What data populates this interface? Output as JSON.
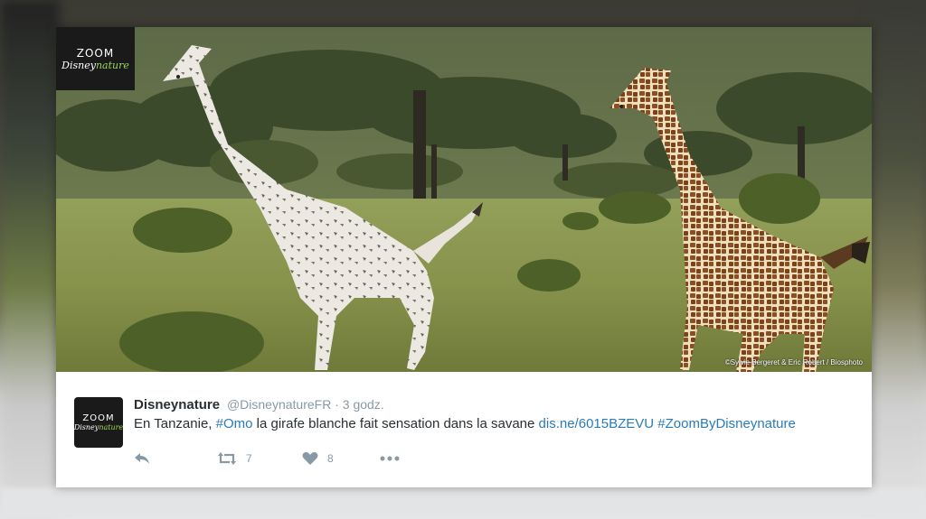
{
  "photo": {
    "logo": {
      "zoom": "ZOOM",
      "brand_prefix": "Disney",
      "brand_suffix": "nature"
    },
    "credit": "©Sylvie Bergeret & Eric Robert / Biosphoto"
  },
  "tweet": {
    "avatar": {
      "zoom": "ZOOM",
      "brand_prefix": "Disney",
      "brand_suffix": "nature"
    },
    "display_name": "Disneynature",
    "handle": "@DisneynatureFR",
    "separator": "·",
    "time": "3 godz.",
    "text": {
      "part1": "En Tanzanie, ",
      "hashtag1": "#Omo",
      "part2": " la girafe blanche fait sensation dans la savane ",
      "link": "dis.ne/6015BZEVU",
      "part3": " ",
      "hashtag2": "#ZoomByDisneynature"
    },
    "actions": {
      "retweet_count": "7",
      "like_count": "8"
    }
  },
  "colors": {
    "link": "#2b7bb9",
    "muted": "#8899a6",
    "text": "#292f33",
    "logo_accent": "#9ad25a"
  },
  "icons": [
    "reply-icon",
    "retweet-icon",
    "heart-icon",
    "more-icon"
  ]
}
